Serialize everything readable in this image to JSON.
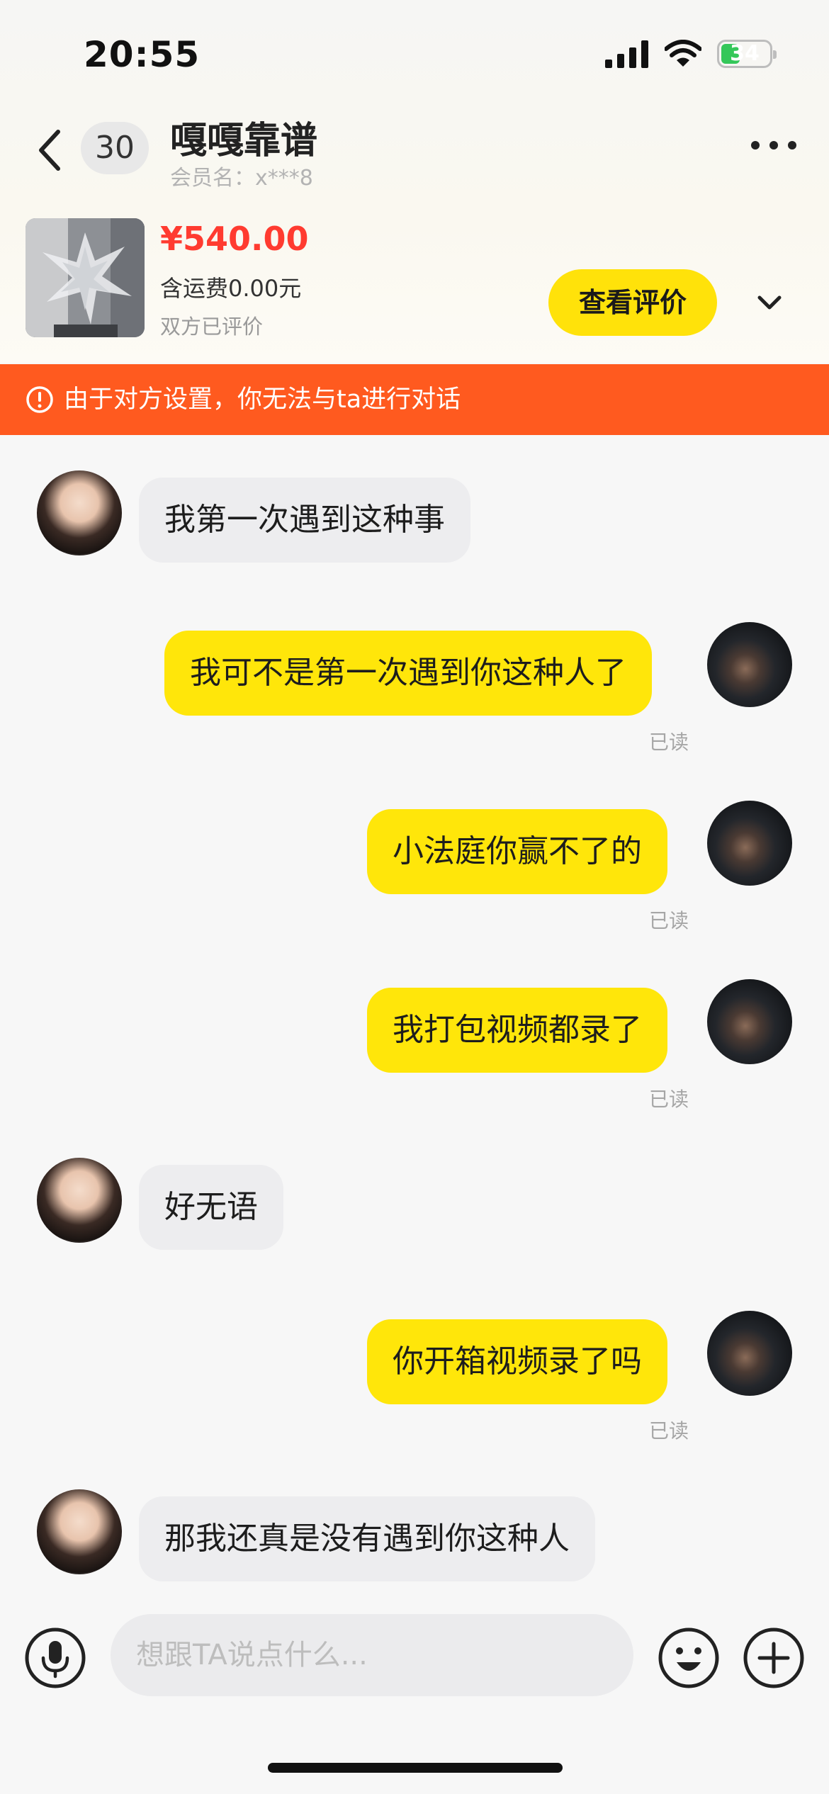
{
  "status_bar": {
    "time": "20:55",
    "battery": "34"
  },
  "header": {
    "unread_count": "30",
    "contact_name": "嘎嘎靠谱",
    "member_label": "会员名：",
    "member_id": "x***8"
  },
  "product": {
    "price": "¥540.00",
    "shipping": "含运费0.00元",
    "status": "双方已评价",
    "review_button": "查看评价"
  },
  "warning": {
    "text": "由于对方设置，你无法与ta进行对话",
    "color": "#ff5a1f"
  },
  "messages": [
    {
      "side": "left",
      "text": "我第一次遇到这种事"
    },
    {
      "side": "right",
      "text": "我可不是第一次遇到你这种人了",
      "read": "已读"
    },
    {
      "side": "right",
      "text": "小法庭你赢不了的",
      "read": "已读"
    },
    {
      "side": "right",
      "text": "我打包视频都录了",
      "read": "已读"
    },
    {
      "side": "left",
      "text": "好无语"
    },
    {
      "side": "right",
      "text": "你开箱视频录了吗",
      "read": "已读"
    },
    {
      "side": "left",
      "text": "那我还真是没有遇到你这种人"
    }
  ],
  "input": {
    "placeholder": "想跟TA说点什么..."
  },
  "colors": {
    "accent_yellow": "#ffe60a",
    "price_red": "#ff3b30",
    "bubble_gray": "#ededef"
  },
  "icons": {
    "back": "back-arrow-icon",
    "more": "more-dots-icon",
    "expand": "chevron-down-icon",
    "warning": "exclamation-circle-icon",
    "voice": "microphone-icon",
    "emoji": "smiley-icon",
    "plus": "plus-circle-icon"
  }
}
